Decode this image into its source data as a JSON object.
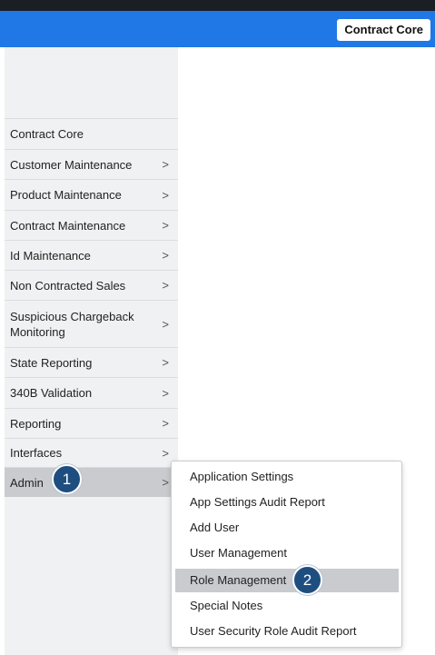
{
  "header": {
    "app_name": "Contract Core"
  },
  "sidebar": {
    "items": [
      {
        "label": "Contract Core",
        "has_submenu": false
      },
      {
        "label": "Customer Maintenance",
        "has_submenu": true
      },
      {
        "label": "Product Maintenance",
        "has_submenu": true
      },
      {
        "label": "Contract Maintenance",
        "has_submenu": true
      },
      {
        "label": "Id Maintenance",
        "has_submenu": true
      },
      {
        "label": "Non Contracted Sales",
        "has_submenu": true
      },
      {
        "label": "Suspicious Chargeback Monitoring",
        "has_submenu": true
      },
      {
        "label": "State Reporting",
        "has_submenu": true
      },
      {
        "label": "340B Validation",
        "has_submenu": true
      },
      {
        "label": "Reporting",
        "has_submenu": true
      },
      {
        "label": "Interfaces",
        "has_submenu": true
      },
      {
        "label": "Admin",
        "has_submenu": true,
        "active": true
      }
    ],
    "chevron": ">"
  },
  "admin_submenu": {
    "items": [
      {
        "label": "Application Settings"
      },
      {
        "label": "App Settings Audit Report"
      },
      {
        "label": "Add User"
      },
      {
        "label": "User Management"
      },
      {
        "label": "Role Management",
        "active": true
      },
      {
        "label": "Special Notes"
      },
      {
        "label": "User Security Role Audit Report"
      }
    ]
  },
  "step_markers": {
    "step1": "1",
    "step2": "2"
  },
  "colors": {
    "topbar": "#1f78e6",
    "sidebar_bg": "#f0f1f2",
    "active_bg": "#c9cbce",
    "step_badge": "#1e4e80"
  }
}
